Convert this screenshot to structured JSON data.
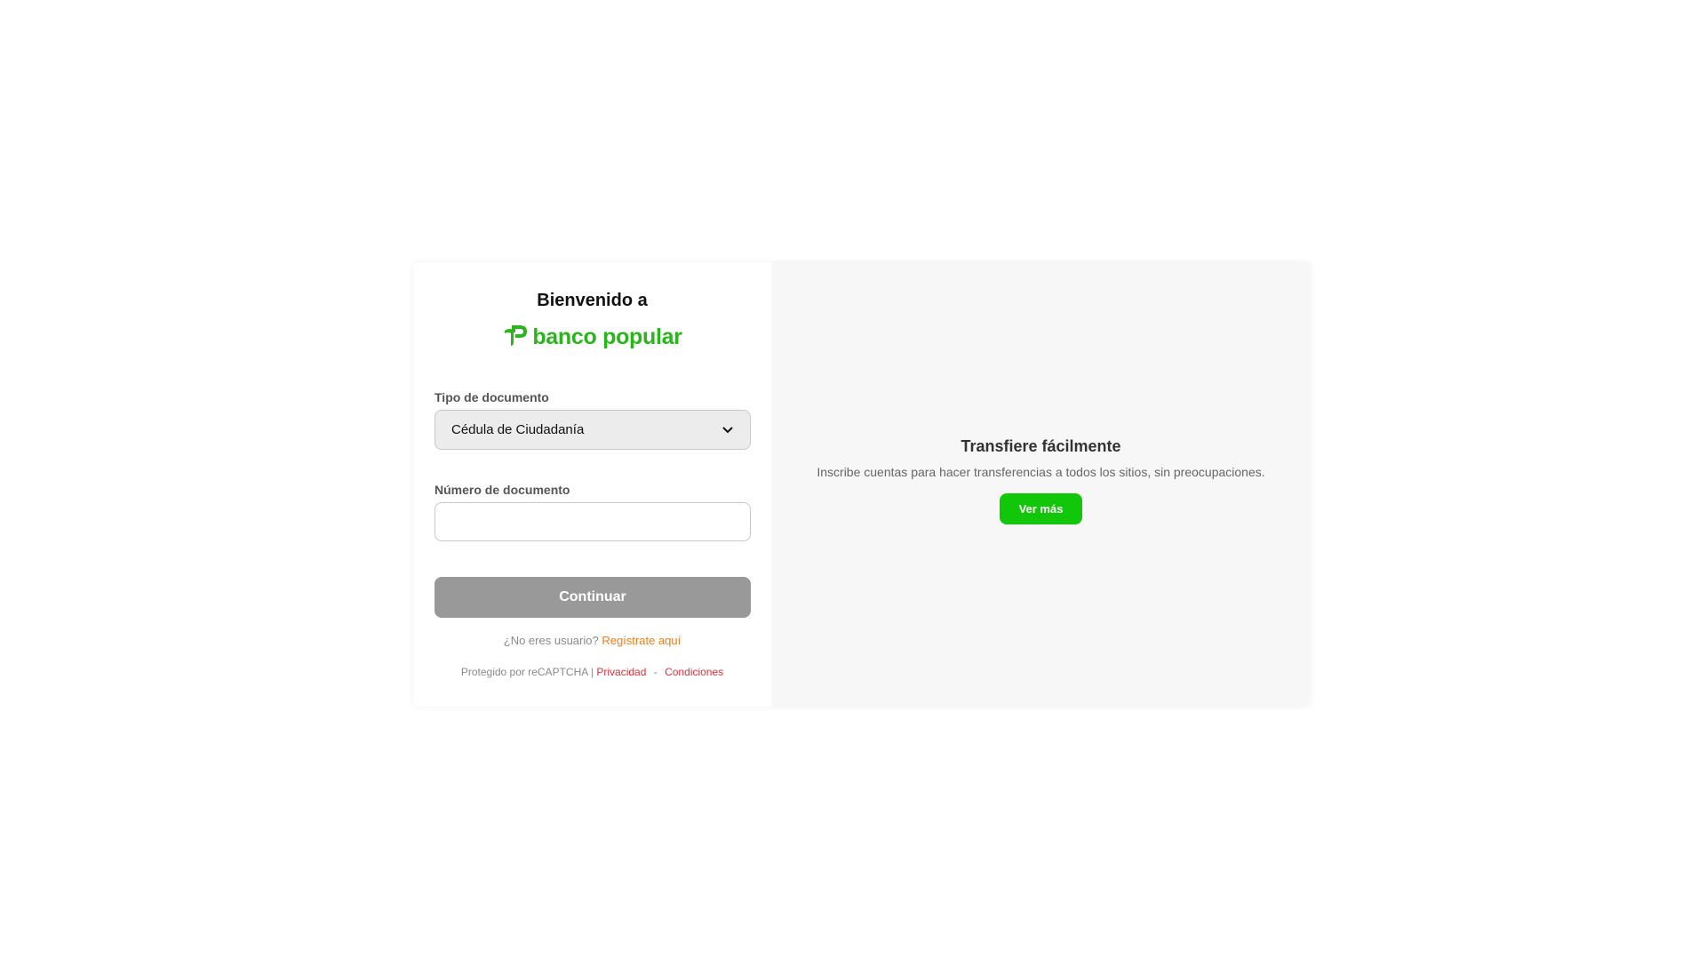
{
  "login": {
    "welcome": "Bienvenido a",
    "brand": "banco popular",
    "brand_color": "#2ab51d",
    "doc_type_label": "Tipo de documento",
    "doc_type_selected": "Cédula de Ciudadanía",
    "doc_number_label": "Número de documento",
    "doc_number_value": "",
    "continue_label": "Continuar",
    "register_prompt": "¿No eres usuario?",
    "register_link": "Regístrate aquí",
    "recaptcha_text": "Protegido por reCAPTCHA |",
    "privacy_link": "Privacidad",
    "separator": "-",
    "terms_link": "Condiciones"
  },
  "promo": {
    "title": "Transfiere fácilmente",
    "text": "Inscribe cuentas para hacer transferencias a todos los sitios, sin preocupaciones.",
    "button_label": "Ver más",
    "button_color": "#12c60a"
  },
  "icons": {
    "logo": "banco-popular-logo-icon",
    "select_arrow": "chevron-down-icon"
  }
}
